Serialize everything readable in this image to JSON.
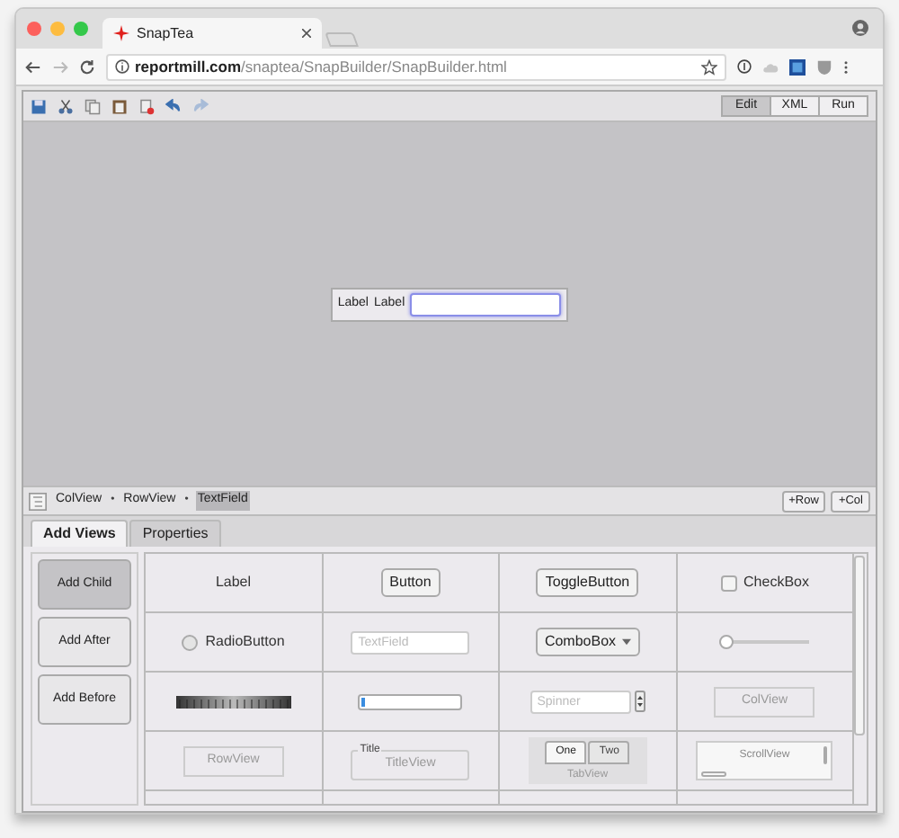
{
  "browser": {
    "tab_title": "SnapTea",
    "url_host": "reportmill.com",
    "url_path": "/snaptea/SnapBuilder/SnapBuilder.html"
  },
  "mode_buttons": [
    {
      "label": "Edit",
      "selected": true
    },
    {
      "label": "XML",
      "selected": false
    },
    {
      "label": "Run",
      "selected": false
    }
  ],
  "canvas": {
    "labels": [
      "Label",
      "Label"
    ],
    "field_focused": true
  },
  "breadcrumb": {
    "separator": "•",
    "items": [
      {
        "label": "ColView",
        "selected": false
      },
      {
        "label": "RowView",
        "selected": false
      },
      {
        "label": "TextField",
        "selected": true
      }
    ]
  },
  "row_buttons": [
    "+Row",
    "+Col"
  ],
  "panel_tabs": [
    {
      "label": "Add Views",
      "selected": true
    },
    {
      "label": "Properties",
      "selected": false
    }
  ],
  "add_buttons": [
    {
      "label": "Add Child",
      "selected": true
    },
    {
      "label": "Add After",
      "selected": false
    },
    {
      "label": "Add Before",
      "selected": false
    }
  ],
  "views": [
    {
      "kind": "label",
      "label": "Label"
    },
    {
      "kind": "button",
      "label": "Button"
    },
    {
      "kind": "button",
      "label": "ToggleButton"
    },
    {
      "kind": "checkbox",
      "label": "CheckBox",
      "checked": false
    },
    {
      "kind": "radio",
      "label": "RadioButton",
      "selected": false
    },
    {
      "kind": "textfield",
      "placeholder": "TextField"
    },
    {
      "kind": "combobox",
      "label": "ComboBox"
    },
    {
      "kind": "slider",
      "level": 0
    },
    {
      "kind": "thumbwheel"
    },
    {
      "kind": "progress",
      "level": 0.02
    },
    {
      "kind": "spinner",
      "placeholder": "Spinner"
    },
    {
      "kind": "box",
      "label": "ColView"
    },
    {
      "kind": "box",
      "label": "RowView"
    },
    {
      "kind": "titleview",
      "title": "Title",
      "label": "TitleView"
    },
    {
      "kind": "tabview",
      "tabs": [
        {
          "label": "One",
          "selected": true
        },
        {
          "label": "Two",
          "selected": false
        }
      ],
      "label": "TabView"
    },
    {
      "kind": "scrollview",
      "label": "ScrollView"
    }
  ]
}
